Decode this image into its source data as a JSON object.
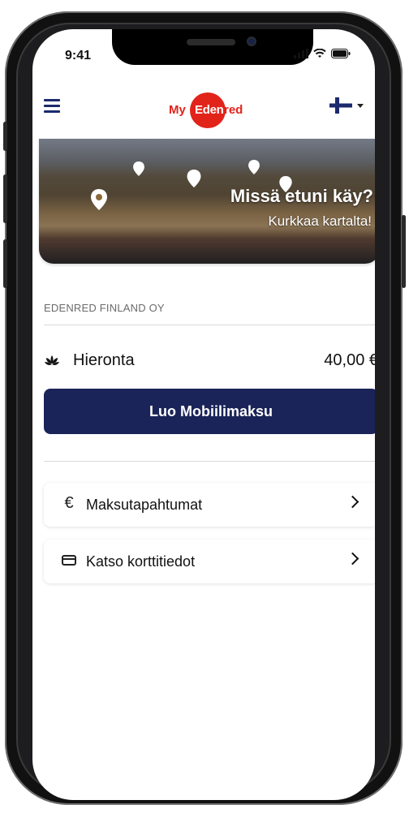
{
  "status": {
    "time": "9:41"
  },
  "header": {
    "logo_my": "My",
    "logo_ed": "Eden",
    "logo_red": "red",
    "language": "fi"
  },
  "banner": {
    "title": "Missä etuni käy?",
    "subtitle": "Kurkkaa kartalta!"
  },
  "account": {
    "company": "EDENRED FINLAND OY",
    "benefit": {
      "label": "Hieronta",
      "amount": "40,00 €",
      "icon": "lotus-icon"
    }
  },
  "actions": {
    "primary_label": "Luo Mobiilimaksu"
  },
  "menu": {
    "items": [
      {
        "label": "Maksutapahtumat",
        "icon": "euro-icon"
      },
      {
        "label": "Katso korttitiedot",
        "icon": "card-icon"
      }
    ]
  },
  "colors": {
    "brand_red": "#e2231a",
    "primary_button": "#1a2458",
    "hamburger": "#1a2a6c"
  }
}
